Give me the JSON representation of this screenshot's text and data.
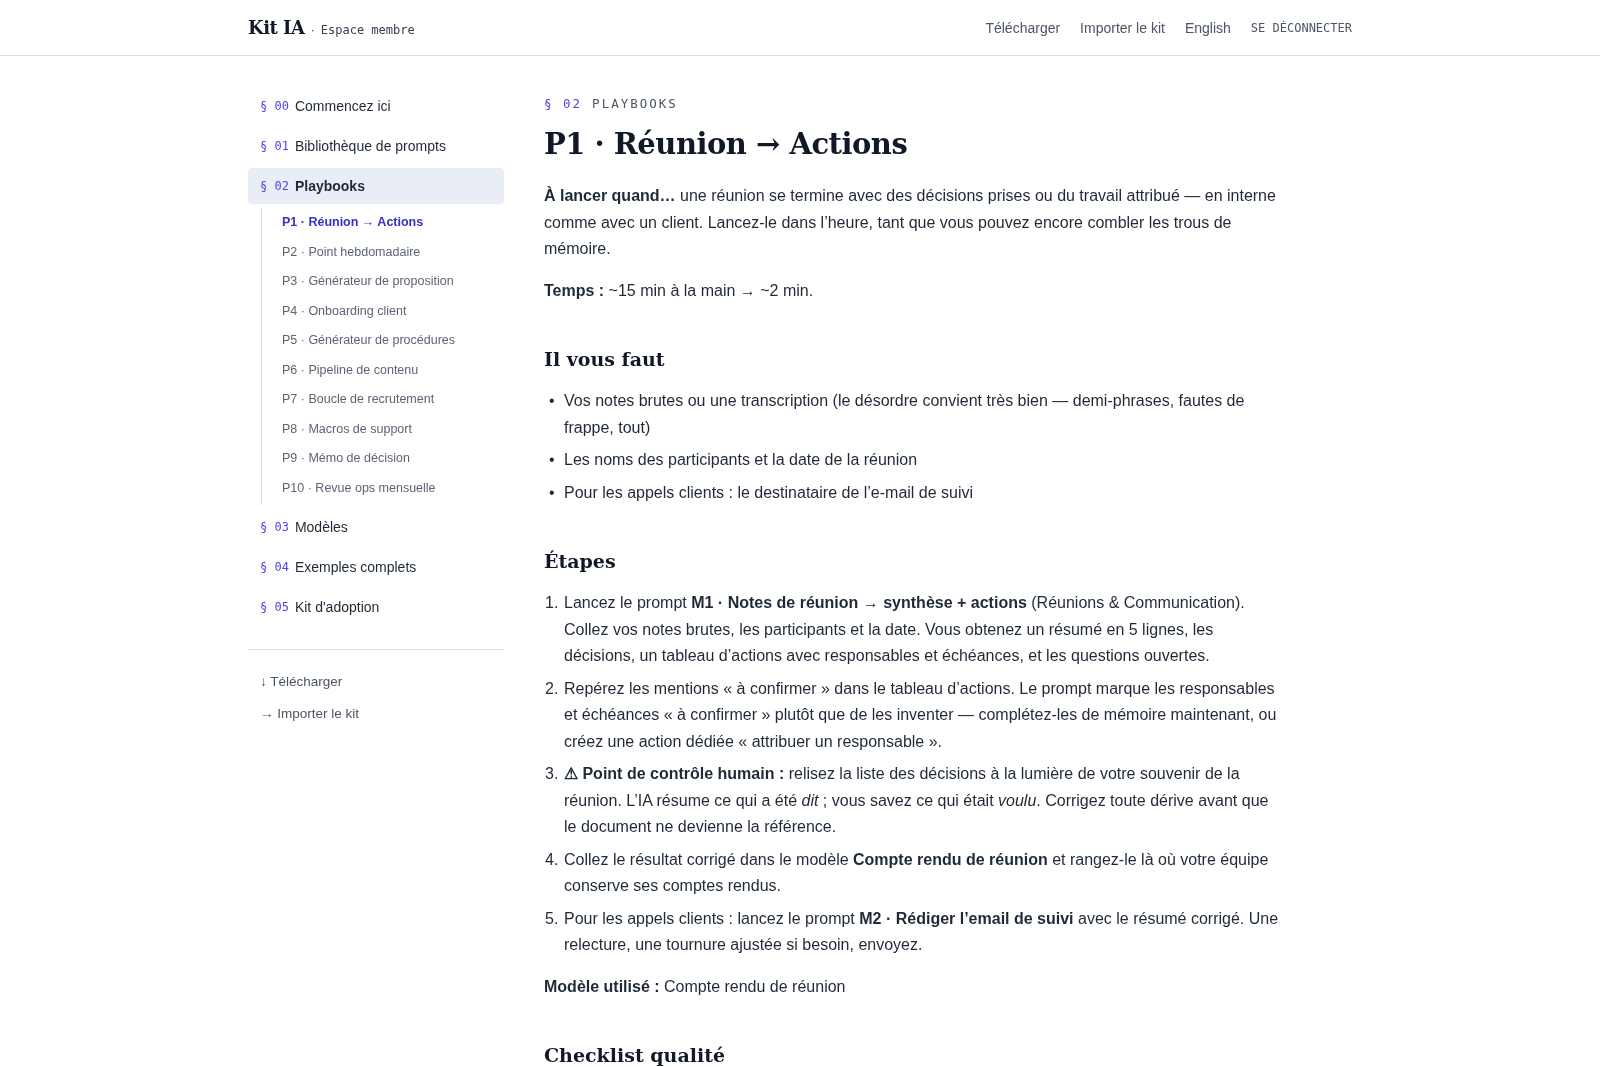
{
  "header": {
    "brand": "Kit IA",
    "separator": "·",
    "subtitle": "Espace membre",
    "nav": [
      {
        "label": "Télécharger",
        "kind": "link"
      },
      {
        "label": "Importer le kit",
        "kind": "link"
      },
      {
        "label": "English",
        "kind": "link"
      },
      {
        "label": "SE DÉCONNECTER",
        "kind": "caps"
      }
    ]
  },
  "sidebar": {
    "sections": [
      {
        "number": "§ 00",
        "label": "Commencez ici",
        "selected": false
      },
      {
        "number": "§ 01",
        "label": "Bibliothèque de prompts",
        "selected": false
      },
      {
        "number": "§ 02",
        "label": "Playbooks",
        "selected": true,
        "children": [
          {
            "label": "P1 · Réunion → Actions",
            "selected": true
          },
          {
            "label": "P2 · Point hebdomadaire",
            "selected": false
          },
          {
            "label": "P3 · Générateur de proposition",
            "selected": false
          },
          {
            "label": "P4 · Onboarding client",
            "selected": false
          },
          {
            "label": "P5 · Générateur de procédures",
            "selected": false
          },
          {
            "label": "P6 · Pipeline de contenu",
            "selected": false
          },
          {
            "label": "P7 · Boucle de recrutement",
            "selected": false
          },
          {
            "label": "P8 · Macros de support",
            "selected": false
          },
          {
            "label": "P9 · Mémo de décision",
            "selected": false
          },
          {
            "label": "P10 · Revue ops mensuelle",
            "selected": false
          }
        ]
      },
      {
        "number": "§ 03",
        "label": "Modèles",
        "selected": false
      },
      {
        "number": "§ 04",
        "label": "Exemples complets",
        "selected": false
      },
      {
        "number": "§ 05",
        "label": "Kit d'adoption",
        "selected": false
      }
    ],
    "links": [
      "↓ Télécharger",
      "→ Importer le kit"
    ]
  },
  "main": {
    "eyebrow_number": "§ 02",
    "eyebrow_label": "PLAYBOOKS",
    "title": "P1 · Réunion → Actions",
    "blocks": [
      {
        "kind": "paragraph",
        "text": "**À lancer quand…** une réunion se termine avec des décisions prises ou du travail attribué — en interne comme avec un client. Lancez-le dans l’heure, tant que vous pouvez encore combler les trous de mémoire."
      },
      {
        "kind": "paragraph",
        "text": "**Temps :** ~15 min à la main → ~2 min."
      },
      {
        "kind": "heading",
        "text": "Il vous faut"
      },
      {
        "kind": "bullets",
        "items": [
          {
            "marker": "•",
            "text": "Vos notes brutes ou une transcription (le désordre convient très bien — demi-phrases, fautes de frappe, tout)"
          },
          {
            "marker": "•",
            "text": "Les noms des participants et la date de la réunion"
          },
          {
            "marker": "•",
            "text": "Pour les appels clients : le destinataire de l’e-mail de suivi"
          }
        ]
      },
      {
        "kind": "heading",
        "text": "Étapes"
      },
      {
        "kind": "steps",
        "items": [
          {
            "marker": "1.",
            "text": "Lancez le prompt **M1 · Notes de réunion → synthèse + actions** (Réunions & Communication). Collez vos notes brutes, les participants et la date. Vous obtenez un résumé en 5 lignes, les décisions, un tableau d’actions avec responsables et échéances, et les questions ouvertes."
          },
          {
            "marker": "2.",
            "text": "Repérez les mentions « à confirmer » dans le tableau d’actions. Le prompt marque les responsables et échéances « à confirmer » plutôt que de les inventer — complétez-les de mémoire maintenant, ou créez une action dédiée « attribuer un responsable »."
          },
          {
            "marker": "3.",
            "text": "**⚠ Point de contrôle humain :** relisez la liste des décisions à la lumière de votre souvenir de la réunion. L’IA résume ce qui a été *dit* ; vous savez ce qui était *voulu*. Corrigez toute dérive avant que le document ne devienne la référence."
          },
          {
            "marker": "4.",
            "text": "Collez le résultat corrigé dans le modèle **Compte rendu de réunion** et rangez-le là où votre équipe conserve ses comptes rendus."
          },
          {
            "marker": "5.",
            "text": "Pour les appels clients : lancez le prompt **M2 · Rédiger l’email de suivi** avec le résumé corrigé. Une relecture, une tournure ajustée si besoin, envoyez."
          }
        ]
      },
      {
        "kind": "paragraph",
        "text": "**Modèle utilisé :** Compte rendu de réunion"
      },
      {
        "kind": "heading",
        "text": "Checklist qualité"
      }
    ]
  }
}
